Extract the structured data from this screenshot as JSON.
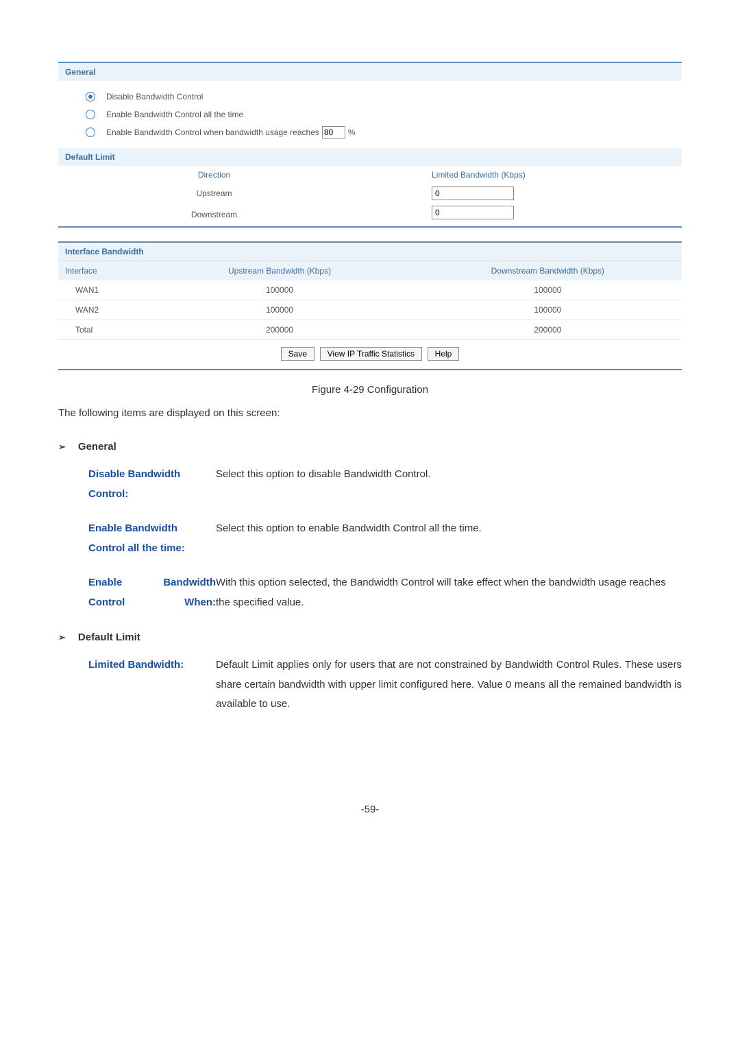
{
  "panel1": {
    "general_header": "General",
    "opt1": "Disable Bandwidth Control",
    "opt2": "Enable Bandwidth Control all the time",
    "opt3_pre": "Enable Bandwidth Control when bandwidth usage reaches",
    "opt3_value": "80",
    "opt3_post": "%",
    "default_limit_header": "Default Limit",
    "col_direction": "Direction",
    "col_limited": "Limited Bandwidth (Kbps)",
    "row_up": "Upstream",
    "row_down": "Downstream",
    "val_up": "0",
    "val_down": "0"
  },
  "panel2": {
    "header": "Interface Bandwidth",
    "col_iface": "Interface",
    "col_up": "Upstream Bandwidth (Kbps)",
    "col_down": "Downstream Bandwidth (Kbps)",
    "rows": [
      {
        "iface": "WAN1",
        "up": "100000",
        "down": "100000"
      },
      {
        "iface": "WAN2",
        "up": "100000",
        "down": "100000"
      },
      {
        "iface": "Total",
        "up": "200000",
        "down": "200000"
      }
    ],
    "btn_save": "Save",
    "btn_stats": "View IP Traffic Statistics",
    "btn_help": "Help"
  },
  "caption": "Figure 4-29 Configuration",
  "intro": "The following items are displayed on this screen:",
  "sec_general": {
    "title": "General",
    "items": [
      {
        "term": "Disable Bandwidth Control:",
        "desc": "Select this option to disable Bandwidth Control."
      },
      {
        "term": "Enable Bandwidth Control all the time:",
        "desc": "Select this option to enable Bandwidth Control all the time."
      },
      {
        "term": "Enable Bandwidth Control When:",
        "desc": "With this option selected, the Bandwidth Control will take effect when the bandwidth usage reaches the specified value."
      }
    ]
  },
  "sec_default": {
    "title": "Default Limit",
    "items": [
      {
        "term": "Limited Bandwidth:",
        "desc": "Default Limit applies only for users that are not constrained by Bandwidth Control Rules. These users share certain bandwidth with upper limit configured here. Value 0 means all the remained bandwidth is available to use."
      }
    ]
  },
  "page_number": "-59-"
}
